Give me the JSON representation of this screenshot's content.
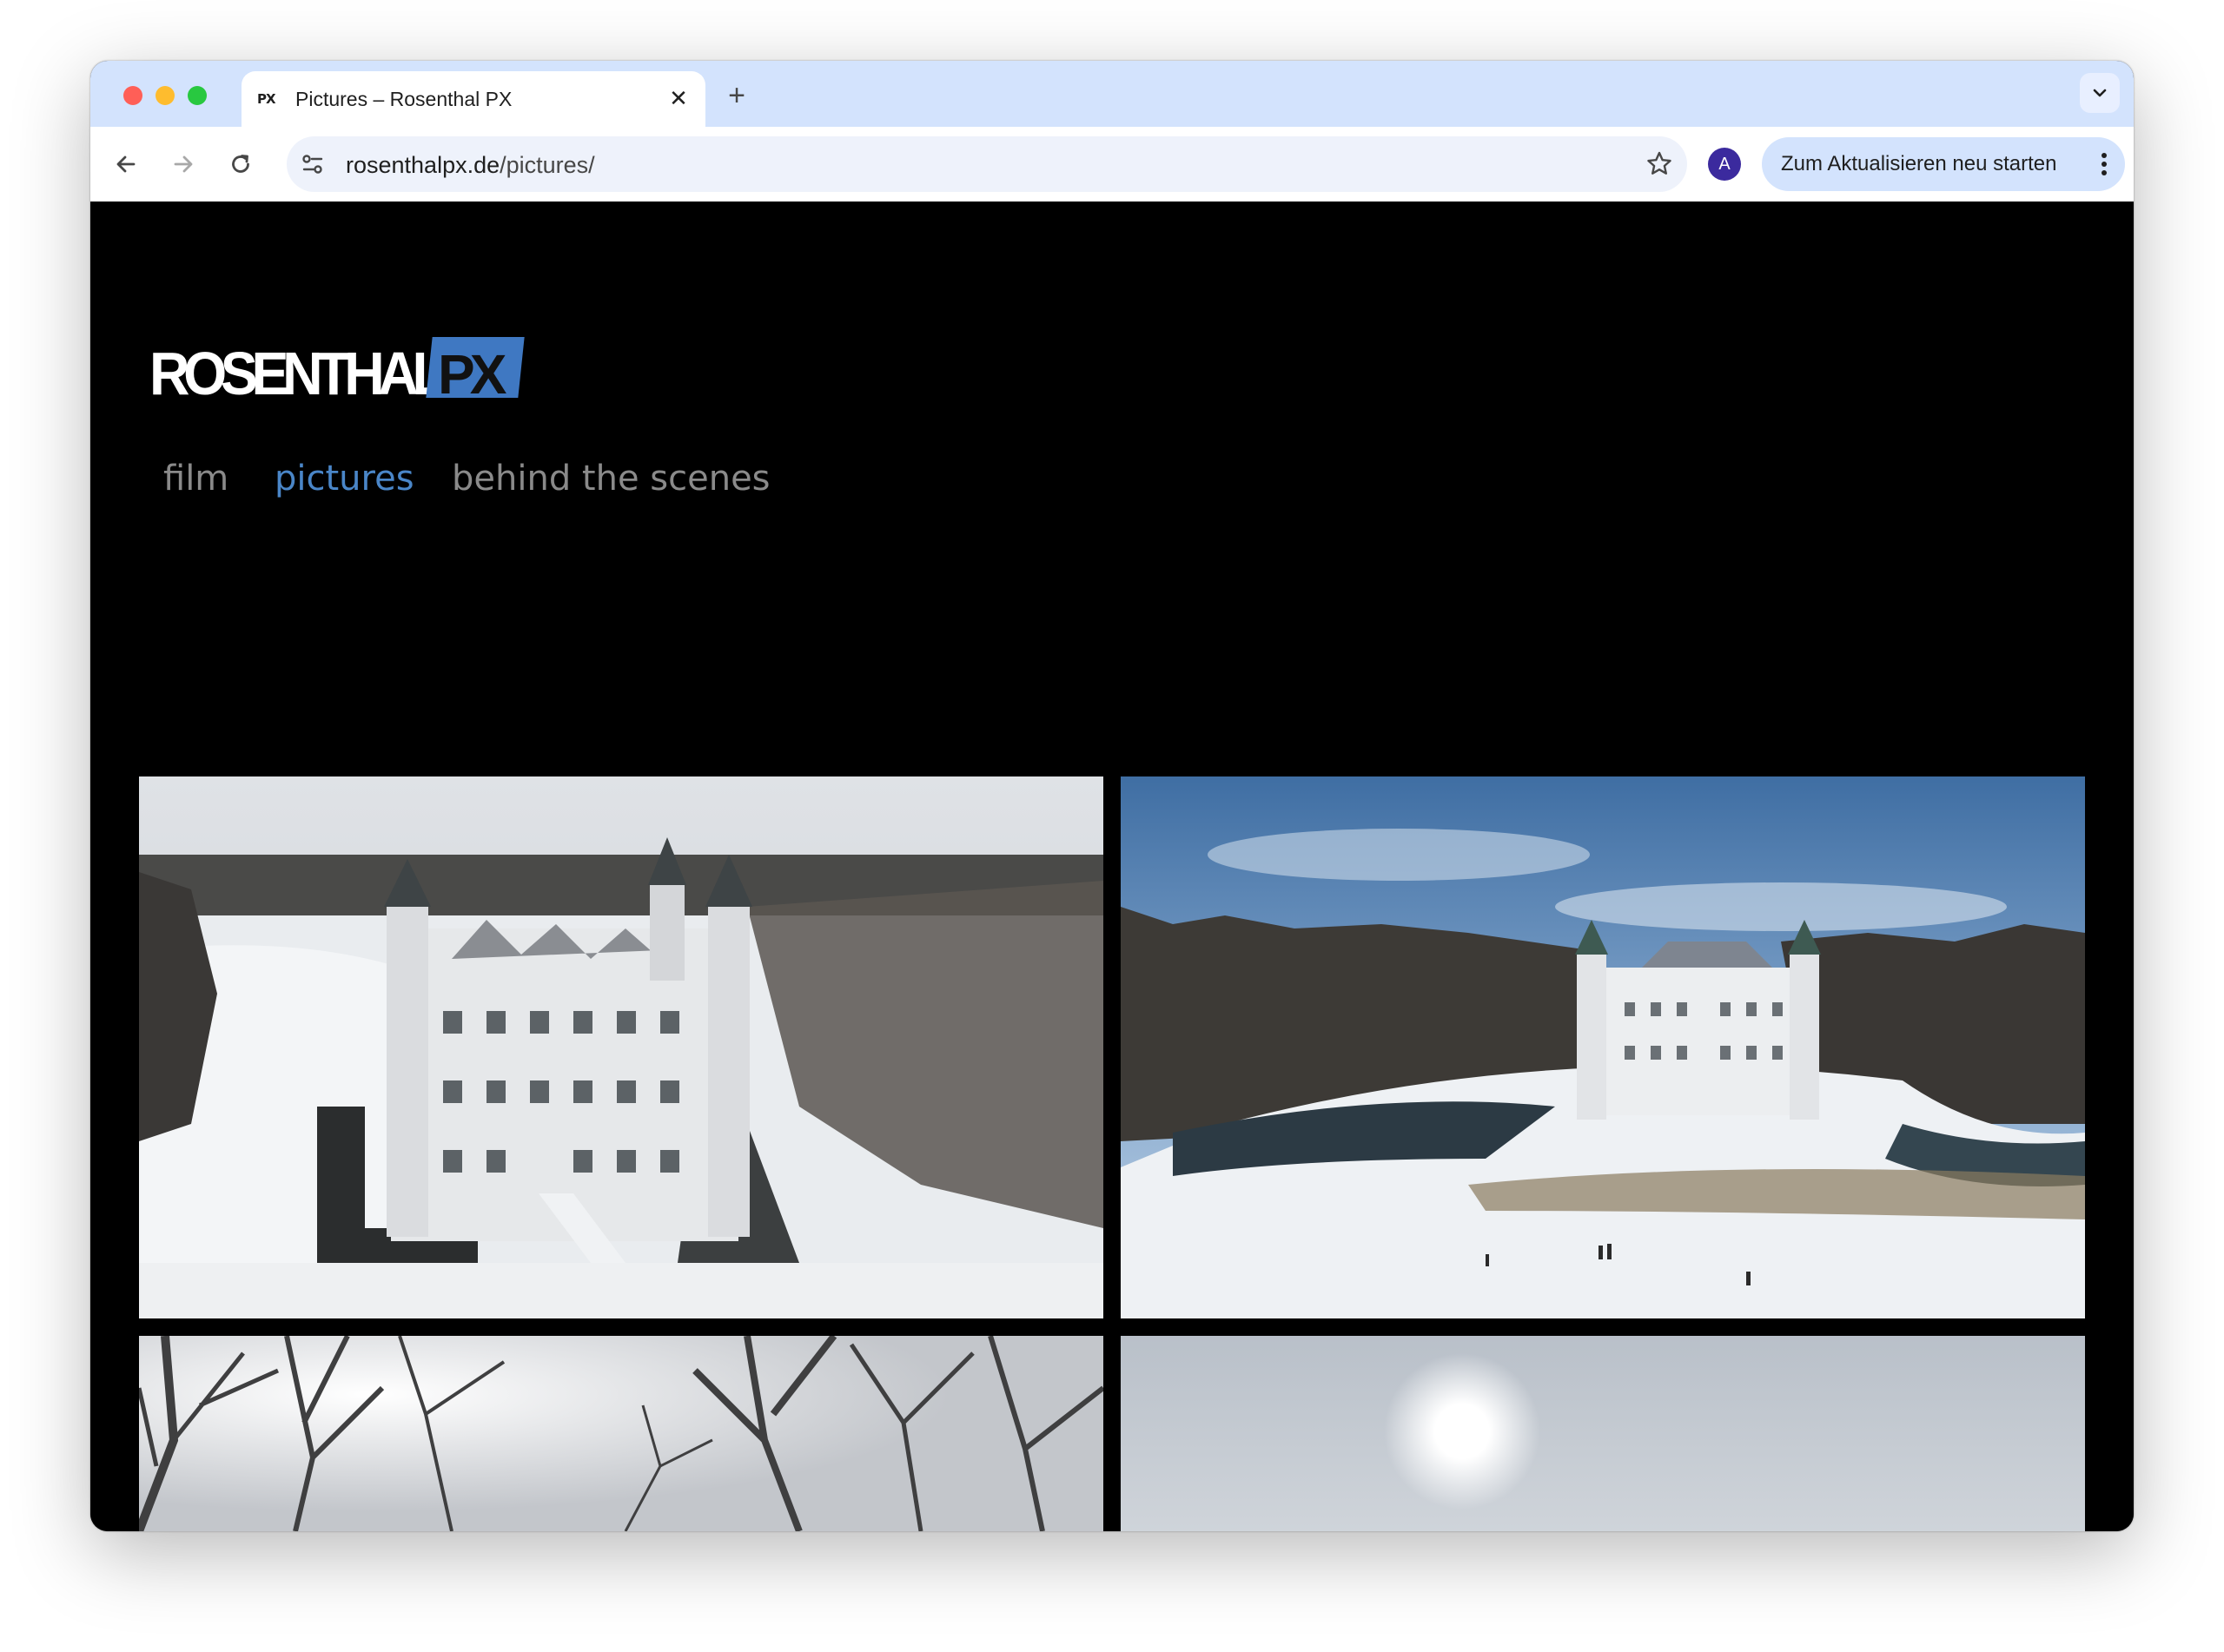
{
  "browser": {
    "tab": {
      "favicon_text": "PX",
      "title": "Pictures – Rosenthal PX",
      "close_icon": "close-icon"
    },
    "new_tab_label": "+",
    "url": {
      "host": "rosenthalpx.de",
      "path": "/pictures/"
    },
    "profile_initial": "A",
    "update_button_label": "Zum Aktualisieren neu starten"
  },
  "site": {
    "logo": {
      "main": "ROSENTHAL",
      "accent": "PX",
      "accent_color": "#3f78c2"
    },
    "nav": [
      {
        "label": "film",
        "active": false
      },
      {
        "label": "pictures",
        "active": true
      },
      {
        "label": "behind the scenes",
        "active": false
      }
    ],
    "active_color": "#4a86c8",
    "inactive_color": "#8a8a8a"
  },
  "gallery": {
    "images": [
      {
        "subject": "snow-covered castle aerial close"
      },
      {
        "subject": "snow-covered castle aerial wide with blue sky"
      },
      {
        "subject": "bare winter trees against bright sky"
      },
      {
        "subject": "sun in pale winter sky"
      }
    ]
  }
}
